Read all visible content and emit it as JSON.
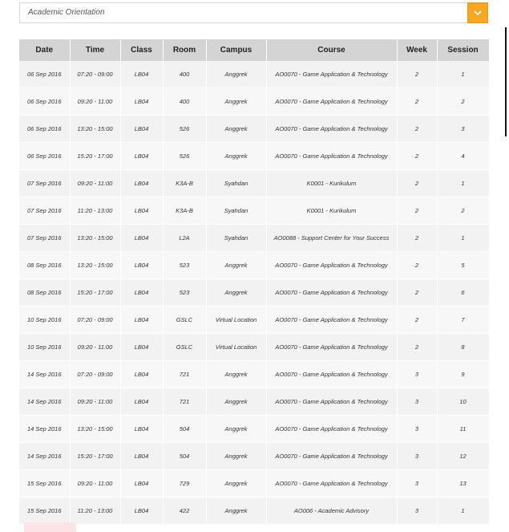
{
  "filter": {
    "selected": "Academic Orientation",
    "toggle_icon": "chevron-down-icon"
  },
  "colors": {
    "accent": "#f7a823",
    "header_bg": "#d4d4d4"
  },
  "table": {
    "headers": [
      "Date",
      "Time",
      "Class",
      "Room",
      "Campus",
      "Course",
      "Week",
      "Session"
    ],
    "rows": [
      [
        "06 Sep 2016",
        "07:20 - 09:00",
        "LB04",
        "400",
        "Anggrek",
        "AO0070 - Game Application & Technology",
        "2",
        "1"
      ],
      [
        "06 Sep 2016",
        "09:20 - 11:00",
        "LB04",
        "400",
        "Anggrek",
        "AO0070 - Game Application & Technology",
        "2",
        "2"
      ],
      [
        "06 Sep 2016",
        "13:20 - 15:00",
        "LB04",
        "526",
        "Anggrek",
        "AO0070 - Game Application & Technology",
        "2",
        "3"
      ],
      [
        "06 Sep 2016",
        "15:20 - 17:00",
        "LB04",
        "526",
        "Anggrek",
        "AO0070 - Game Application & Technology",
        "2",
        "4"
      ],
      [
        "07 Sep 2016",
        "09:20 - 11:00",
        "LB04",
        "K3A-B",
        "Syahdan",
        "K0001 - Kurikulum",
        "2",
        "1"
      ],
      [
        "07 Sep 2016",
        "11:20 - 13:00",
        "LB04",
        "K3A-B",
        "Syahdan",
        "K0001 - Kurikulum",
        "2",
        "2"
      ],
      [
        "07 Sep 2016",
        "13:20 - 15:00",
        "LB04",
        "L2A",
        "Syahdan",
        "AO0088 - Support Center for Your Success",
        "2",
        "1"
      ],
      [
        "08 Sep 2016",
        "13:20 - 15:00",
        "LB04",
        "523",
        "Anggrek",
        "AO0070 - Game Application & Technology",
        "2",
        "5"
      ],
      [
        "08 Sep 2016",
        "15:20 - 17:00",
        "LB04",
        "523",
        "Anggrek",
        "AO0070 - Game Application & Technology",
        "2",
        "6"
      ],
      [
        "10 Sep 2016",
        "07:20 - 09:00",
        "LB04",
        "GSLC",
        "Virtual Location",
        "AO0070 - Game Application & Technology",
        "2",
        "7"
      ],
      [
        "10 Sep 2016",
        "09:20 - 11:00",
        "LB04",
        "GSLC",
        "Virtual Location",
        "AO0070 - Game Application & Technology",
        "2",
        "8"
      ],
      [
        "14 Sep 2016",
        "07:20 - 09:00",
        "LB04",
        "721",
        "Anggrek",
        "AO0070 - Game Application & Technology",
        "3",
        "9"
      ],
      [
        "14 Sep 2016",
        "09:20 - 11:00",
        "LB04",
        "721",
        "Anggrek",
        "AO0070 - Game Application & Technology",
        "3",
        "10"
      ],
      [
        "14 Sep 2016",
        "13:20 - 15:00",
        "LB04",
        "504",
        "Anggrek",
        "AO0070 - Game Application & Technology",
        "3",
        "11"
      ],
      [
        "14 Sep 2016",
        "15:20 - 17:00",
        "LB04",
        "504",
        "Anggrek",
        "AO0070 - Game Application & Technology",
        "3",
        "12"
      ],
      [
        "15 Sep 2016",
        "09:20 - 11:00",
        "LB04",
        "729",
        "Anggrek",
        "AO0070 - Game Application & Technology",
        "3",
        "13"
      ],
      [
        "15 Sep 2016",
        "11:20 - 13:00",
        "LB04",
        "422",
        "Anggrek",
        "AO006 - Academic Advisory",
        "3",
        "1"
      ]
    ]
  }
}
